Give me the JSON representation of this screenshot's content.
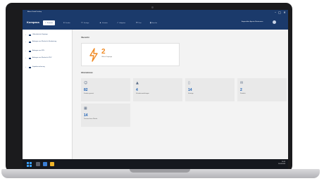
{
  "window": {
    "title": "Allianz Virtual Desktop",
    "controls": {
      "minimize": "–",
      "maximize": "□",
      "close": "✕"
    }
  },
  "app": {
    "brand": "Kompass",
    "tabs": [
      {
        "label": "Startseite",
        "icon": "home-icon",
        "active": true
      },
      {
        "label": "Kunden",
        "icon": "person-icon"
      },
      {
        "label": "Verträge",
        "icon": "document-icon"
      },
      {
        "label": "Schaden",
        "icon": "warning-icon"
      },
      {
        "label": "Aufgaben",
        "icon": "check-icon"
      },
      {
        "label": "Post",
        "icon": "mail-icon"
      },
      {
        "label": "Berichte",
        "icon": "chart-icon"
      }
    ],
    "user": {
      "name": "Angemeldet: Agentur Mustermann"
    }
  },
  "sidebar": {
    "items": [
      {
        "label": "Unbearbeitete Vorgänge"
      },
      {
        "label": "Anfragen zum Wechsel in Bearbeitung"
      },
      {
        "label": "Anfragen zum PKV"
      },
      {
        "label": "Anfragen zum Wechsel in PKV"
      },
      {
        "label": "Kapitalversicherung"
      }
    ]
  },
  "main": {
    "overview_title": "Übersicht",
    "featured": {
      "value": "2",
      "label": "Offene Vorgänge"
    },
    "info_title": "Informationen",
    "tiles": [
      {
        "icon": "people-icon",
        "value": "82",
        "label": "Kunden gesamt"
      },
      {
        "icon": "warning-icon",
        "value": "4",
        "label": "Schadensmeldungen"
      },
      {
        "icon": "document-icon",
        "value": "14",
        "label": "Verträge"
      },
      {
        "icon": "mail-icon",
        "value": "2",
        "label": "Postfach"
      },
      {
        "icon": "calendar-icon",
        "value": "14",
        "label": "Termine diese Woche"
      }
    ]
  },
  "taskbar": {
    "time": "10:15",
    "date": "15.03.2023"
  },
  "colors": {
    "app_bar": "#1b3a6b",
    "accent_orange": "#f08a24",
    "accent_blue": "#1b5fb4",
    "taskbar": "#15181e"
  }
}
